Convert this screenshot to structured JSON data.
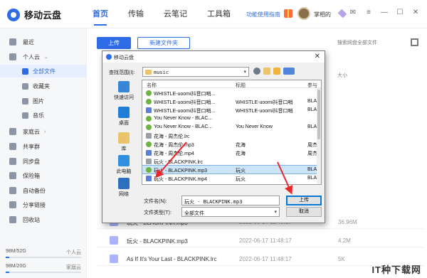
{
  "app": {
    "name": "移动云盘",
    "colors": {
      "brand": "#2e6be6",
      "arrow": "#e8262b"
    }
  },
  "topnav": {
    "tabs": [
      {
        "label": "首页",
        "active": true
      },
      {
        "label": "传输"
      },
      {
        "label": "云笔记"
      },
      {
        "label": "工具箱"
      }
    ],
    "guide_link": "功能使用指南",
    "username": "掌相的"
  },
  "sidebar": {
    "items": [
      {
        "label": "最近",
        "icon": "clock-icon"
      },
      {
        "label": "个人云",
        "icon": "cloud-icon",
        "expandable": true
      },
      {
        "label": "全部文件",
        "icon": "folder-icon",
        "active": true
      },
      {
        "label": "收藏夹",
        "icon": "star-icon"
      },
      {
        "label": "图片",
        "icon": "image-icon"
      },
      {
        "label": "音乐",
        "icon": "music-icon"
      },
      {
        "label": "家庭云",
        "icon": "home-icon",
        "expandable": true
      },
      {
        "label": "共享群",
        "icon": "group-icon"
      },
      {
        "label": "同步盘",
        "icon": "sync-icon"
      },
      {
        "label": "保险箱",
        "icon": "safe-icon"
      },
      {
        "label": "自动备份",
        "icon": "backup-icon"
      },
      {
        "label": "分享链接",
        "icon": "share-icon"
      },
      {
        "label": "回收站",
        "icon": "trash-icon"
      }
    ],
    "quota_personal": {
      "used": "98M/52G",
      "label": "个人云",
      "fraction": 0.05
    },
    "quota_family": {
      "used": "98M/20G",
      "label": "家庭云",
      "fraction": 0.05
    }
  },
  "main": {
    "upload_label": "上传",
    "new_folder_label": "新建文件夹",
    "search_placeholder": "搜索网盘全部文件",
    "col_size": "大小",
    "rows": [
      {
        "name": "玩火 - BLACKPINK.mp3",
        "date": "2022-06-17 11:48:17",
        "size": "36.96M"
      },
      {
        "name": "玩火 - BLACKPINK.mp3",
        "date": "2022-06-17 11:48:17",
        "size": "4.2M"
      },
      {
        "name": "As If It's Your Last - BLACKPINK.lrc",
        "date": "2022-06-17 11:48:17",
        "size": "5K"
      }
    ]
  },
  "dialog": {
    "title": "移动云盘",
    "close": "✕",
    "look_in_label": "查找范围(I):",
    "look_in_value": "music",
    "places": [
      "快速访问",
      "桌面",
      "库",
      "此电脑",
      "网络"
    ],
    "columns": [
      "名称",
      "标题",
      "参与"
    ],
    "files": [
      {
        "name": "WHISTLE-uoomi抖音口哨...",
        "title": "",
        "artist": "",
        "kind": "audio"
      },
      {
        "name": "WHISTLE-uoomi抖音口哨...",
        "title": "WHISTLE-uoomi抖音口哨",
        "artist": "BLA",
        "kind": "audio"
      },
      {
        "name": "WHISTLE-uoomi抖音口哨...",
        "title": "WHISTLE-uoomi抖音口哨",
        "artist": "BLA",
        "kind": "video"
      },
      {
        "name": "You Never Know - BLAC...",
        "title": "",
        "artist": "",
        "kind": "audio"
      },
      {
        "name": "You Never Know - BLAC...",
        "title": "You Never Know",
        "artist": "BLA",
        "kind": "audio"
      },
      {
        "name": "花海 - 周杰伦.lrc",
        "title": "",
        "artist": "",
        "kind": "lrc"
      },
      {
        "name": "花海 - 周杰伦.mp3",
        "title": "花海",
        "artist": "周杰",
        "kind": "audio"
      },
      {
        "name": "花海 - 周杰伦.mp4",
        "title": "花海",
        "artist": "周杰",
        "kind": "video"
      },
      {
        "name": "玩火 - BLACKPINK.lrc",
        "title": "",
        "artist": "",
        "kind": "lrc"
      },
      {
        "name": "玩火 - BLACKPINK.mp3",
        "title": "玩火",
        "artist": "BLA",
        "kind": "audio",
        "selected": true
      },
      {
        "name": "玩火 - BLACKPINK.mp4",
        "title": "玩火",
        "artist": "BLA",
        "kind": "video"
      }
    ],
    "filename_label": "文件名(N):",
    "filename_value": "玩火 - BLACKPINK.mp3",
    "filetype_label": "文件类型(T):",
    "filetype_value": "全部文件",
    "ok_label": "上传",
    "cancel_label": "取消"
  },
  "watermark": "IT种下载网"
}
